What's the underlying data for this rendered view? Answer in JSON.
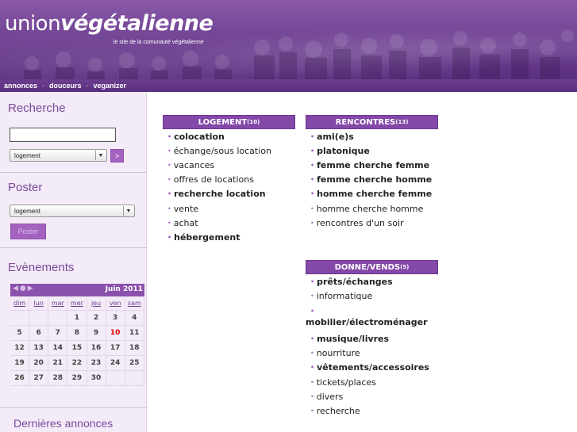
{
  "header": {
    "logo_part1": "union",
    "logo_part2": "végétalienne",
    "tagline": "le site de la comunauté végétalienne"
  },
  "nav": {
    "items": [
      "annonces",
      "douceurs",
      "veganizer"
    ],
    "separator": "-"
  },
  "sidebar": {
    "search": {
      "title": "Recherche",
      "input_value": "",
      "select_value": "logement",
      "go_label": ">"
    },
    "post": {
      "title": "Poster",
      "select_value": "logement",
      "button_label": "Poster"
    },
    "events": {
      "title": "Evènements",
      "calendar": {
        "nav": "◀●▶",
        "month": "Juin 2011",
        "days_of_week": [
          "dim",
          "lun",
          "mar",
          "mer",
          "jeu",
          "ven",
          "sam"
        ],
        "weeks": [
          [
            "",
            "",
            "",
            "1",
            "2",
            "3",
            "4"
          ],
          [
            "5",
            "6",
            "7",
            "8",
            "9",
            "10",
            "11"
          ],
          [
            "12",
            "13",
            "14",
            "15",
            "16",
            "17",
            "18"
          ],
          [
            "19",
            "20",
            "21",
            "22",
            "23",
            "24",
            "25"
          ],
          [
            "26",
            "27",
            "28",
            "29",
            "30",
            "",
            ""
          ]
        ],
        "today": "10"
      }
    },
    "latest": {
      "title": "Dernières annonces"
    }
  },
  "categories": {
    "logement": {
      "title": "LOGEMENT",
      "count": "(10)",
      "items": [
        {
          "label": "colocation",
          "bold": true
        },
        {
          "label": "échange/sous location",
          "bold": false
        },
        {
          "label": "vacances",
          "bold": false
        },
        {
          "label": "offres de locations",
          "bold": false
        },
        {
          "label": "recherche location",
          "bold": true
        },
        {
          "label": "vente",
          "bold": false
        },
        {
          "label": "achat",
          "bold": false
        },
        {
          "label": "hébergement",
          "bold": true
        }
      ]
    },
    "rencontres": {
      "title": "RENCONTRES",
      "count": "(13)",
      "items": [
        {
          "label": "ami(e)s",
          "bold": true
        },
        {
          "label": "platonique",
          "bold": true
        },
        {
          "label": "femme cherche femme",
          "bold": true
        },
        {
          "label": "femme cherche homme",
          "bold": true
        },
        {
          "label": "homme cherche femme",
          "bold": true
        },
        {
          "label": "homme cherche homme",
          "bold": false
        },
        {
          "label": "rencontres d'un soir",
          "bold": false
        }
      ]
    },
    "donne": {
      "title": "DONNE/VENDS",
      "count": "(5)",
      "items": [
        {
          "label": "prêts/échanges",
          "bold": true
        },
        {
          "label": "informatique",
          "bold": false
        },
        {
          "label": "mobilier/électroménager",
          "bold": true,
          "stack": true
        },
        {
          "label": "musique/livres",
          "bold": true
        },
        {
          "label": "nourriture",
          "bold": false
        },
        {
          "label": "vêtements/accessoires",
          "bold": true
        },
        {
          "label": "tickets/places",
          "bold": false
        },
        {
          "label": "divers",
          "bold": false
        },
        {
          "label": "recherche",
          "bold": false
        }
      ]
    }
  },
  "colors": {
    "brand_purple": "#7b4a9c",
    "header_purple": "#6d3f91",
    "button_purple": "#a463c0",
    "today_red": "#e00000"
  }
}
